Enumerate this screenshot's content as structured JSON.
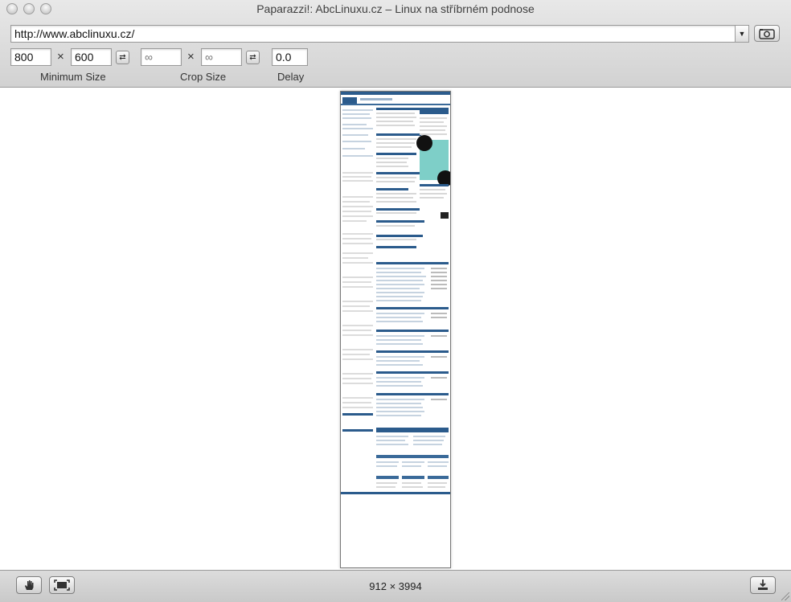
{
  "window": {
    "title": "Paparazzi!: AbcLinuxu.cz – Linux na stříbrném podnose"
  },
  "toolbar": {
    "url": "http://www.abclinuxu.cz/",
    "min_width": "800",
    "min_height": "600",
    "crop_width_placeholder": "∞",
    "crop_height_placeholder": "∞",
    "times": "×",
    "delay": "0.0",
    "min_size_label": "Minimum Size",
    "crop_size_label": "Crop Size",
    "delay_label": "Delay"
  },
  "status": {
    "dimensions": "912 × 3994"
  },
  "colors": {
    "accent": "#2b5b8c",
    "header": "#3a6a99"
  }
}
